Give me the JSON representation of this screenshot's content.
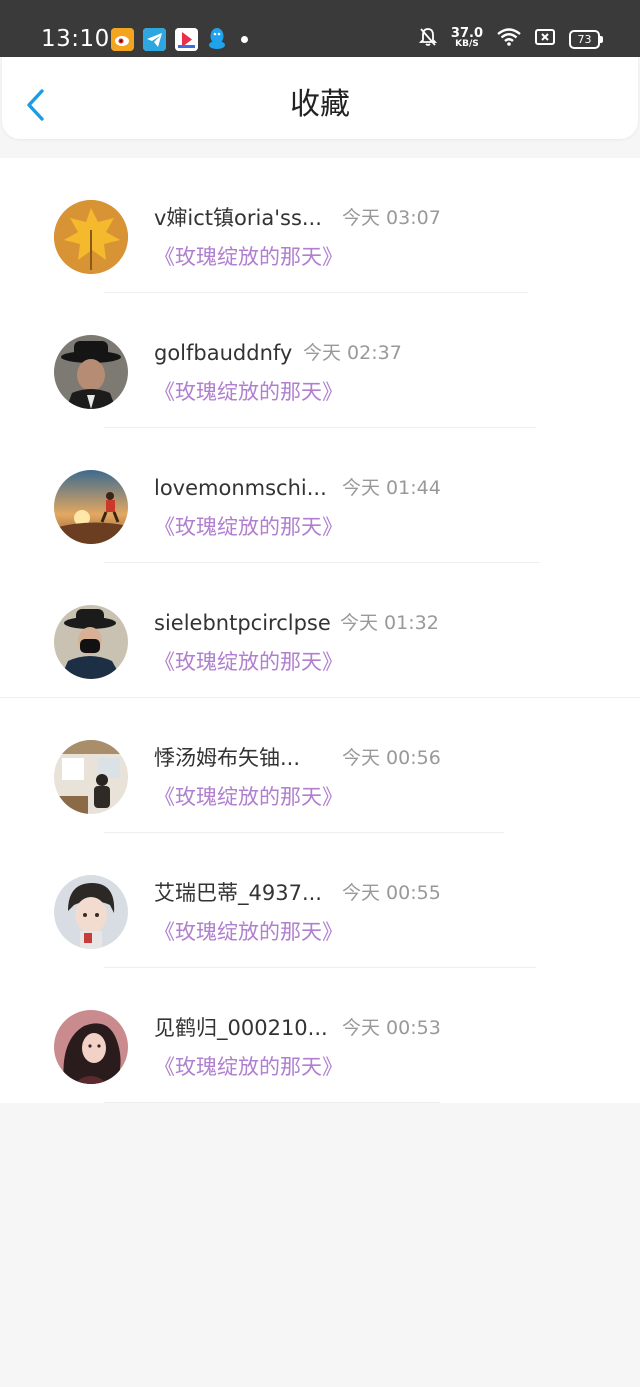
{
  "status_bar": {
    "time": "13:10",
    "net_speed": "37.0",
    "net_unit": "KB/S",
    "battery": "73",
    "app_icons": [
      "weibo-icon",
      "telegram-icon",
      "video-app-icon",
      "qq-icon"
    ],
    "indicators": [
      "bell-muted-icon",
      "wifi-icon",
      "close-box-icon",
      "battery-icon"
    ]
  },
  "header": {
    "title": "收藏",
    "back_icon": "chevron-left-icon",
    "accent_color": "#1e9be6"
  },
  "colors": {
    "book_title": "#b07fcf",
    "timestamp": "#999999",
    "name": "#333333"
  },
  "favorites": [
    {
      "name": "v婶ict镇oria'ss...",
      "time": "今天 03:07",
      "book": "《玫瑰绽放的那天》",
      "avatar": "maple-leaf-avatar"
    },
    {
      "name": "golfbauddnfy",
      "time": "今天 02:37",
      "book": "《玫瑰绽放的那天》",
      "avatar": "man-in-hat-avatar"
    },
    {
      "name": "lovemonmschi...",
      "time": "今天 01:44",
      "book": "《玫瑰绽放的那天》",
      "avatar": "sunset-runner-avatar"
    },
    {
      "name": "sielebntpcirclpse",
      "time": "今天 01:32",
      "book": "《玫瑰绽放的那天》",
      "avatar": "masked-man-avatar"
    },
    {
      "name": "悸汤姆布矢铀...",
      "time": "今天 00:56",
      "book": "《玫瑰绽放的那天》",
      "avatar": "cafe-scene-avatar"
    },
    {
      "name": "艾瑞巴蒂_4937...",
      "time": "今天 00:55",
      "book": "《玫瑰绽放的那天》",
      "avatar": "anime-boy-avatar"
    },
    {
      "name": "见鹤归_000210...",
      "time": "今天 00:53",
      "book": "《玫瑰绽放的那天》",
      "avatar": "anime-girl-avatar"
    }
  ]
}
